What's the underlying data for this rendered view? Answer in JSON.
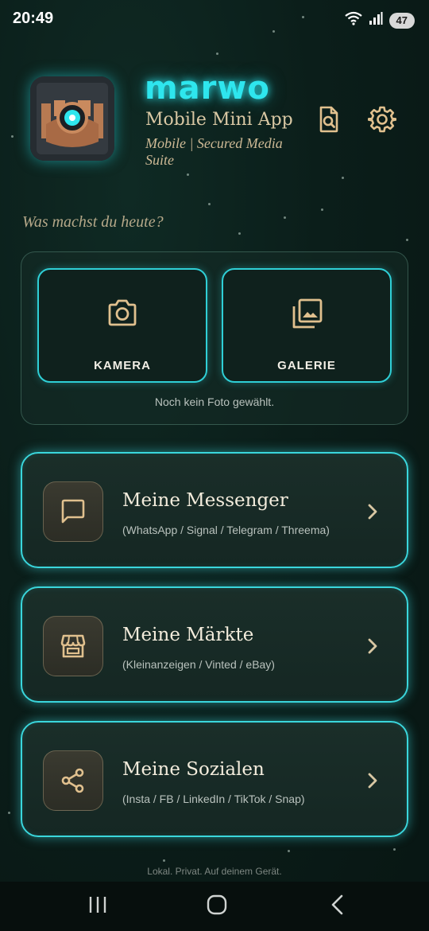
{
  "status_bar": {
    "time": "20:49",
    "battery": "47",
    "icons": [
      "wifi-icon",
      "signal-icon",
      "battery-icon"
    ]
  },
  "header": {
    "brand": "marwo",
    "subtitle": "Mobile Mini App",
    "tagline": "Mobile | Secured Media Suite",
    "logo_icon": "app-logo",
    "actions": [
      "document-search-icon",
      "gear-icon"
    ]
  },
  "prompt": "Was machst du heute?",
  "photo_panel": {
    "camera_label": "KAMERA",
    "gallery_label": "GALERIE",
    "status": "Noch kein Foto gewählt."
  },
  "menu": [
    {
      "icon": "chat-bubble-icon",
      "title": "Meine Messenger",
      "subtitle": "(WhatsApp / Signal / Telegram / Threema)"
    },
    {
      "icon": "storefront-icon",
      "title": "Meine Märkte",
      "subtitle": "(Kleinanzeigen / Vinted / eBay)"
    },
    {
      "icon": "share-icon",
      "title": "Meine Sozialen",
      "subtitle": "(Insta / FB / LinkedIn / TikTok / Snap)"
    }
  ],
  "footer": "Lokal. Privat. Auf deinem Gerät.",
  "nav": [
    "recents-icon",
    "home-icon",
    "back-icon"
  ],
  "colors": {
    "accent_cyan": "#2ee6ee",
    "gold": "#d9b98a",
    "background": "#0b1e1a"
  }
}
